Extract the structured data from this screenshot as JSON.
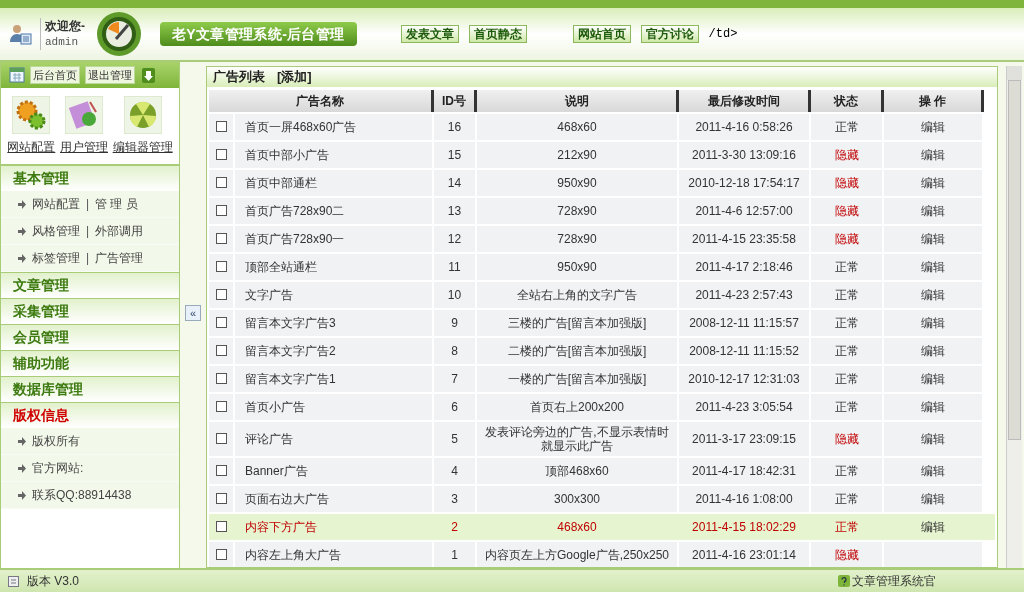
{
  "header": {
    "welcome": "欢迎您-",
    "user": "admin",
    "title": "老Y文章管理系统-后台管理",
    "links": [
      "发表文章",
      "首页静态",
      "网站首页",
      "官方讨论"
    ],
    "stray_text": "/td>"
  },
  "sidebar": {
    "top_buttons": [
      "后台首页",
      "退出管理"
    ],
    "shortcuts": [
      {
        "kind": "gears",
        "label": "网站配置"
      },
      {
        "kind": "clipboard",
        "label": "用户管理"
      },
      {
        "kind": "ball",
        "label": "编辑器管理"
      }
    ],
    "separator": "|",
    "sections": [
      {
        "title": "基本管理",
        "highlighted": false,
        "rows": [
          [
            "网站配置",
            "管 理 员"
          ],
          [
            "风格管理",
            "外部调用"
          ],
          [
            "标签管理",
            "广告管理"
          ]
        ]
      },
      {
        "title": "文章管理",
        "highlighted": false
      },
      {
        "title": "采集管理",
        "highlighted": false
      },
      {
        "title": "会员管理",
        "highlighted": false
      },
      {
        "title": "辅助功能",
        "highlighted": false
      },
      {
        "title": "数据库管理",
        "highlighted": false
      },
      {
        "title": "版权信息",
        "highlighted": true,
        "rows": [
          [
            "版权所有"
          ],
          [
            "官方网站:"
          ],
          [
            "联系QQ:88914438"
          ]
        ]
      }
    ]
  },
  "collapse_button": "«",
  "panel": {
    "title": "广告列表",
    "add_link": "[添加]",
    "columns": [
      "广告名称",
      "ID号",
      "说明",
      "最后修改时间",
      "状态",
      "操 作"
    ],
    "rows": [
      {
        "name": "首页一屏468x60广告",
        "id": "16",
        "desc": "468x60",
        "time": "2011-4-16 0:58:26",
        "status": "正常",
        "hidden": false,
        "highlighted": false,
        "action": "编辑",
        "checked": false
      },
      {
        "name": "首页中部小广告",
        "id": "15",
        "desc": "212x90",
        "time": "2011-3-30 13:09:16",
        "status": "隐藏",
        "hidden": true,
        "highlighted": false,
        "action": "编辑",
        "checked": false
      },
      {
        "name": "首页中部通栏",
        "id": "14",
        "desc": "950x90",
        "time": "2010-12-18 17:54:17",
        "status": "隐藏",
        "hidden": true,
        "highlighted": false,
        "action": "编辑",
        "checked": false
      },
      {
        "name": "首页广告728x90二",
        "id": "13",
        "desc": "728x90",
        "time": "2011-4-6 12:57:00",
        "status": "隐藏",
        "hidden": true,
        "highlighted": false,
        "action": "编辑",
        "checked": false
      },
      {
        "name": "首页广告728x90一",
        "id": "12",
        "desc": "728x90",
        "time": "2011-4-15 23:35:58",
        "status": "隐藏",
        "hidden": true,
        "highlighted": false,
        "action": "编辑",
        "checked": false
      },
      {
        "name": "顶部全站通栏",
        "id": "11",
        "desc": "950x90",
        "time": "2011-4-17 2:18:46",
        "status": "正常",
        "hidden": false,
        "highlighted": false,
        "action": "编辑",
        "checked": false
      },
      {
        "name": "文字广告",
        "id": "10",
        "desc": "全站右上角的文字广告",
        "time": "2011-4-23 2:57:43",
        "status": "正常",
        "hidden": false,
        "highlighted": false,
        "action": "编辑",
        "checked": false
      },
      {
        "name": "留言本文字广告3",
        "id": "9",
        "desc": "三楼的广告[留言本加强版]",
        "time": "2008-12-11 11:15:57",
        "status": "正常",
        "hidden": false,
        "highlighted": false,
        "action": "编辑",
        "checked": false
      },
      {
        "name": "留言本文字广告2",
        "id": "8",
        "desc": "二楼的广告[留言本加强版]",
        "time": "2008-12-11 11:15:52",
        "status": "正常",
        "hidden": false,
        "highlighted": false,
        "action": "编辑",
        "checked": false
      },
      {
        "name": "留言本文字广告1",
        "id": "7",
        "desc": "一楼的广告[留言本加强版]",
        "time": "2010-12-17 12:31:03",
        "status": "正常",
        "hidden": false,
        "highlighted": false,
        "action": "编辑",
        "checked": false
      },
      {
        "name": "首页小广告",
        "id": "6",
        "desc": "首页右上200x200",
        "time": "2011-4-23 3:05:54",
        "status": "正常",
        "hidden": false,
        "highlighted": false,
        "action": "编辑",
        "checked": false
      },
      {
        "name": "评论广告",
        "id": "5",
        "desc": "发表评论旁边的广告,不显示表情时就显示此广告",
        "time": "2011-3-17 23:09:15",
        "status": "隐藏",
        "hidden": true,
        "highlighted": false,
        "action": "编辑",
        "checked": false
      },
      {
        "name": "Banner广告",
        "id": "4",
        "desc": "顶部468x60",
        "time": "2011-4-17 18:42:31",
        "status": "正常",
        "hidden": false,
        "highlighted": false,
        "action": "编辑",
        "checked": false
      },
      {
        "name": "页面右边大广告",
        "id": "3",
        "desc": "300x300",
        "time": "2011-4-16 1:08:00",
        "status": "正常",
        "hidden": false,
        "highlighted": false,
        "action": "编辑",
        "checked": false
      },
      {
        "name": "内容下方广告",
        "id": "2",
        "desc": "468x60",
        "time": "2011-4-15 18:02:29",
        "status": "正常",
        "hidden": false,
        "highlighted": true,
        "action": "编辑",
        "checked": false
      },
      {
        "name": "内容左上角大广告",
        "id": "1",
        "desc": "内容页左上方Google广告,250x250",
        "time": "2011-4-16 23:01:14",
        "status": "隐藏",
        "hidden": true,
        "highlighted": false,
        "checked": false
      }
    ]
  },
  "footer": {
    "version": "版本 V3.0",
    "right_text": "文章管理系统官"
  }
}
